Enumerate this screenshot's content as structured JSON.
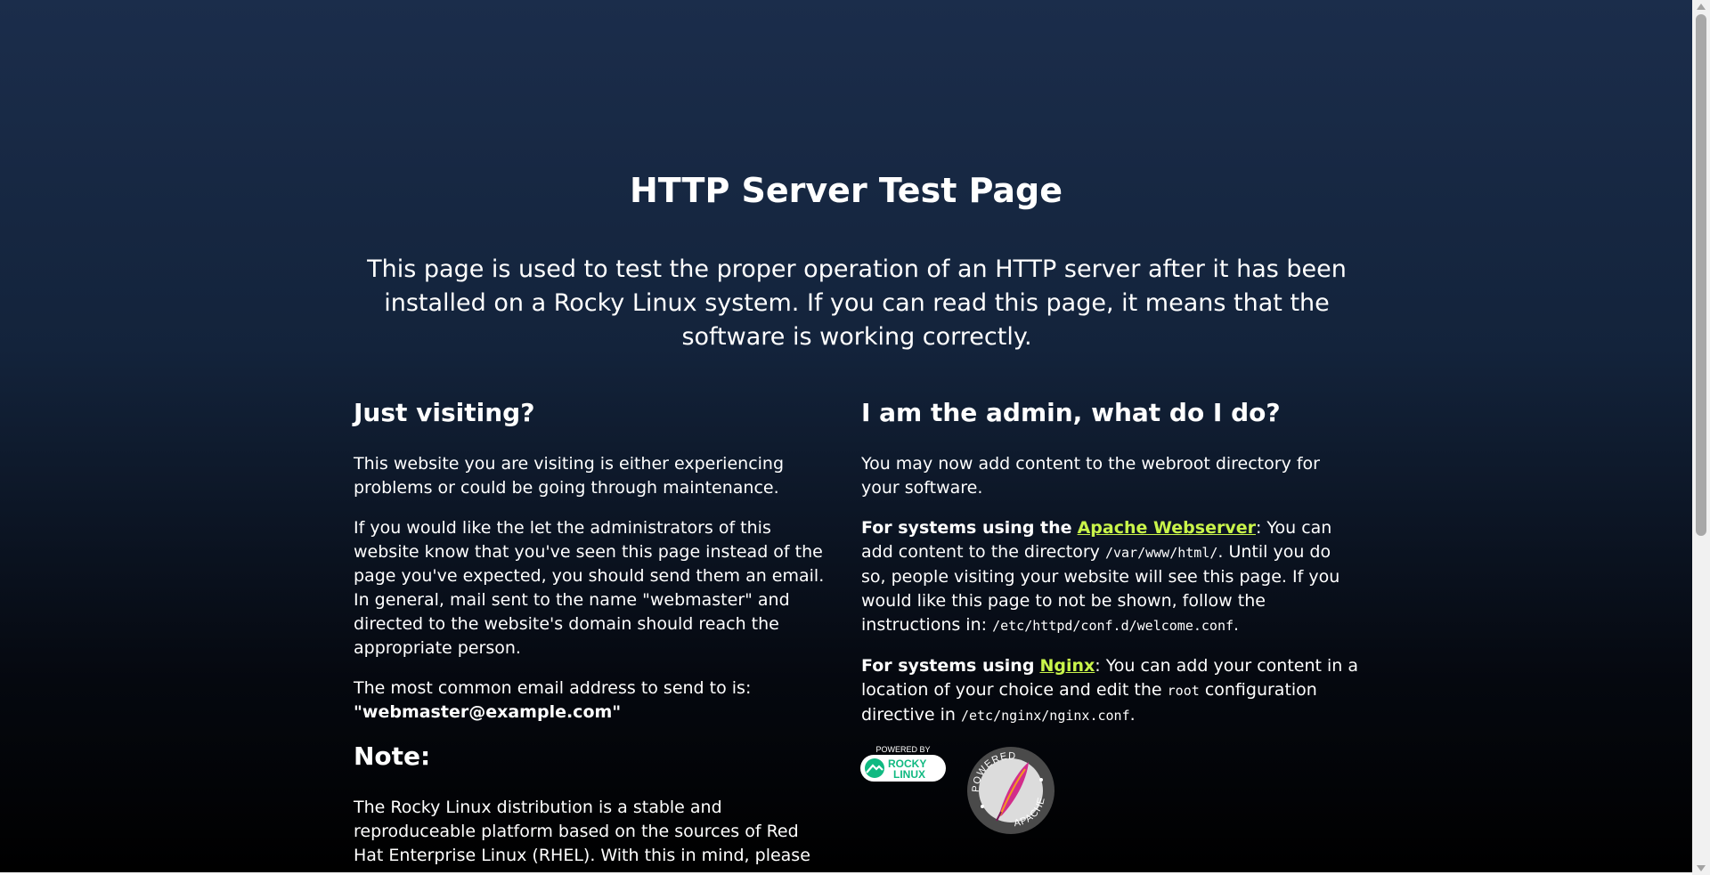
{
  "title": "HTTP Server Test Page",
  "intro": "This page is used to test the proper operation of an HTTP server after it has been installed on a Rocky Linux system. If you can read this page, it means that the software is working correctly.",
  "left": {
    "heading": "Just visiting?",
    "p1": "This website you are visiting is either experiencing problems or could be going through maintenance.",
    "p2": "If you would like the let the administrators of this website know that you've seen this page instead of the page you've expected, you should send them an email. In general, mail sent to the name \"webmaster\" and directed to the website's domain should reach the appropriate person.",
    "p3_text": "The most common email address to send to is:",
    "p3_email": "\"webmaster@example.com\"",
    "note_heading": "Note:",
    "note_text": "The Rocky Linux distribution is a stable and reproduceable platform based on the sources of Red Hat Enterprise Linux (RHEL). With this in mind, please understand that:"
  },
  "right": {
    "heading": "I am the admin, what do I do?",
    "p1": "You may now add content to the webroot directory for your software.",
    "apache_prefix": "For systems using the",
    "apache_link": "Apache Webserver",
    "apache_t1": ": You can add content to the directory",
    "apache_code1": "/var/www/html/",
    "apache_t2": ". Until you do so, people visiting your website will see this page. If you would like this page to not be shown, follow the instructions in:",
    "apache_code2": "/etc/httpd/conf.d/welcome.conf",
    "apache_t3": ".",
    "nginx_prefix": "For systems using",
    "nginx_link": "Nginx",
    "nginx_t1": ": You can add your content in a location of your choice and edit the",
    "nginx_code1": "root",
    "nginx_t2": "configuration directive in",
    "nginx_code2": "/etc/nginx/nginx.conf",
    "nginx_t3": "."
  },
  "badges": {
    "rocky_top": "POWERED BY",
    "rocky_main1": "ROCKY",
    "rocky_main2": "LINUX",
    "apache_top": "POWERED BY",
    "apache_bottom": "APACHE"
  },
  "colors": {
    "link": "#c9f44a",
    "rocky_green": "#10b981",
    "apache_feather": "#d22d8b"
  },
  "icons": [
    "rocky-linux-logo-icon",
    "apache-feather-icon",
    "scroll-up-arrow-icon",
    "scroll-down-arrow-icon"
  ]
}
